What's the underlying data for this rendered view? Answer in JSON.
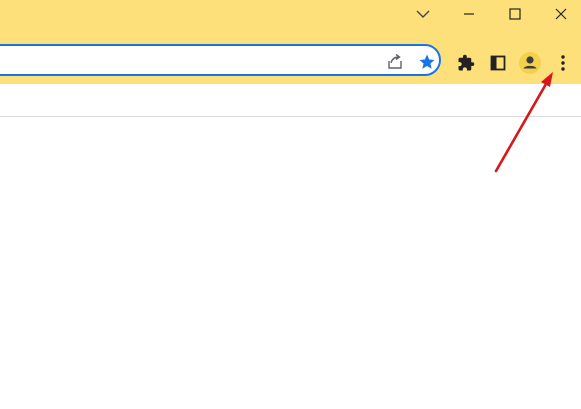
{
  "window_controls": {
    "tab_search": "chevron-down-icon",
    "minimize": "minimize-icon",
    "maximize": "maximize-icon",
    "close": "close-icon"
  },
  "omnibox": {
    "share_icon": "share-icon",
    "bookmark_icon": "star-icon",
    "bookmark_state": "bookmarked"
  },
  "toolbar": {
    "extensions_icon": "puzzle-icon",
    "side_panel_icon": "side-panel-icon",
    "profile_icon": "avatar-icon",
    "menu_icon": "kebab-menu-icon"
  },
  "annotation": {
    "type": "arrow",
    "color": "#d9161b",
    "points_to": "menu-button"
  },
  "colors": {
    "frame": "#fde07a",
    "accent": "#1a73e8",
    "avatar_bg": "#f5d04a"
  }
}
